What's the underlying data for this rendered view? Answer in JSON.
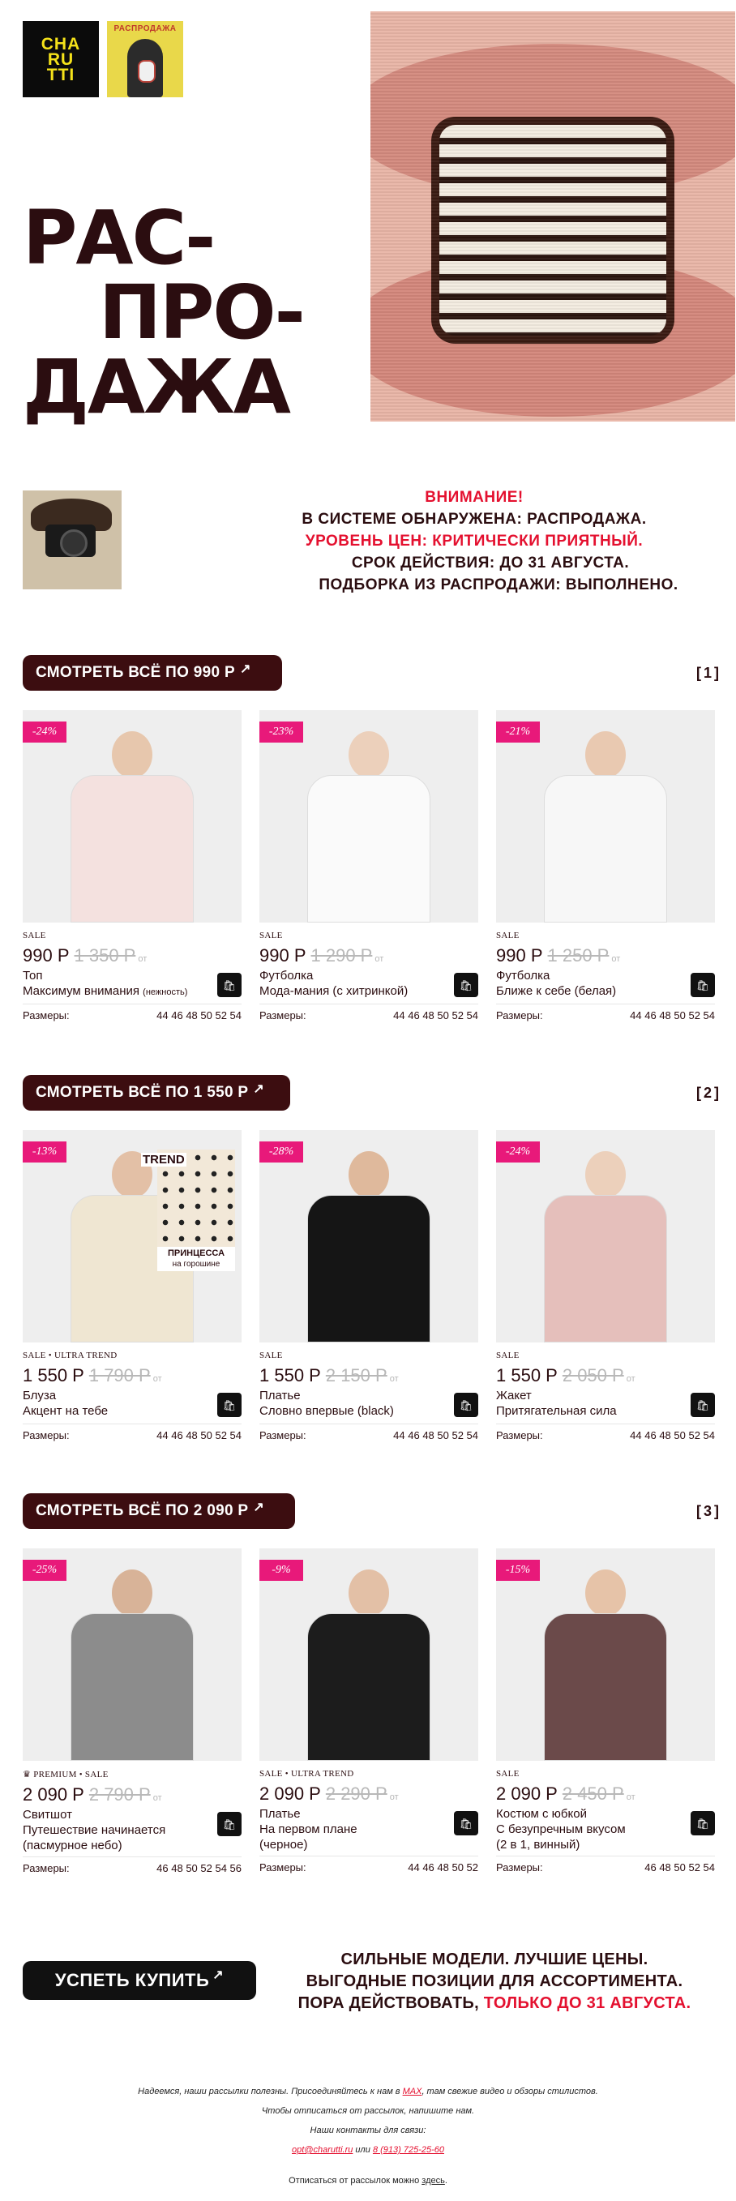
{
  "header": {
    "logo_text": "CHA RU TTI",
    "promo_label": "РАСПРОДАЖА",
    "title_lines": [
      "РАС-",
      "ПРО-",
      "ДАЖА"
    ]
  },
  "notice": {
    "lines": [
      {
        "text": "ВНИМАНИЕ!",
        "red": true
      },
      {
        "text": "В СИСТЕМЕ ОБНАРУЖЕНА: РАСПРОДАЖА.",
        "red": false
      },
      {
        "text": "УРОВЕНЬ ЦЕН: КРИТИЧЕСКИ ПРИЯТНЫЙ.",
        "red": true
      },
      {
        "text": "СРОК ДЕЙСТВИЯ: ДО 31 АВГУСТА.",
        "red": false
      },
      {
        "text": "ПОДБОРКА ИЗ РАСПРОДАЖИ: ВЫПОЛНЕНО.",
        "red": false
      }
    ]
  },
  "sections": [
    {
      "button": "СМОТРЕТЬ ВСЁ ПО 990 Р",
      "number": "[1]",
      "products": [
        {
          "badge": "-24%",
          "tag": "SALE",
          "price": "990 Р",
          "old_price": "1 350 Р",
          "from": "от",
          "line1": "Топ",
          "line2": "Максимум внимания",
          "line2_small": "(нежность)",
          "sizes_label": "Размеры:",
          "sizes": "44 46 48 50 52 54",
          "skin": "#e7c7ad",
          "outfit": "#f4e1df"
        },
        {
          "badge": "-23%",
          "tag": "SALE",
          "price": "990 Р",
          "old_price": "1 290 Р",
          "from": "от",
          "line1": "Футболка",
          "line2": "Мода-мания (с хитринкой)",
          "line2_small": "",
          "sizes_label": "Размеры:",
          "sizes": "44 46 48 50 52 54",
          "skin": "#ecd0bb",
          "outfit": "#fafafa"
        },
        {
          "badge": "-21%",
          "tag": "SALE",
          "price": "990 Р",
          "old_price": "1 250 Р",
          "from": "от",
          "line1": "Футболка",
          "line2": "Ближе к себе (белая)",
          "line2_small": "",
          "sizes_label": "Размеры:",
          "sizes": "44 46 48 50 52 54",
          "skin": "#e9c9b1",
          "outfit": "#f7f7f7"
        }
      ]
    },
    {
      "button": "СМОТРЕТЬ ВСЁ ПО 1 550 Р",
      "number": "[2]",
      "products": [
        {
          "badge": "-13%",
          "tag": "SALE • ULTRA TREND",
          "price": "1 550 Р",
          "old_price": "1 790 Р",
          "from": "от",
          "line1": "Блуза",
          "line2": "Акцент на тебе",
          "line2_small": "",
          "sizes_label": "Размеры:",
          "sizes": "44 46 48 50 52 54",
          "skin": "#e3c0a6",
          "outfit": "#efe6d2",
          "trend": "TREND",
          "trend_caption_1": "ПРИНЦЕССА",
          "trend_caption_2": "на горошине"
        },
        {
          "badge": "-28%",
          "tag": "SALE",
          "price": "1 550 Р",
          "old_price": "2 150 Р",
          "from": "от",
          "line1": "Платье",
          "line2": "Словно впервые (black)",
          "line2_small": "",
          "sizes_label": "Размеры:",
          "sizes": "44 46 48 50 52 54",
          "skin": "#dfb99c",
          "outfit": "#151515"
        },
        {
          "badge": "-24%",
          "tag": "SALE",
          "price": "1 550 Р",
          "old_price": "2 050 Р",
          "from": "от",
          "line1": "Жакет",
          "line2": "Притягательная сила",
          "line2_small": "",
          "sizes_label": "Размеры:",
          "sizes": "44 46 48 50 52 54",
          "skin": "#ecd0bb",
          "outfit": "#e5bfbb"
        }
      ]
    },
    {
      "button": "СМОТРЕТЬ ВСЁ ПО 2 090 Р",
      "number": "[3]",
      "products": [
        {
          "badge": "-25%",
          "tag": "♛ PREMIUM • SALE",
          "price": "2 090 Р",
          "old_price": "2 790 Р",
          "from": "от",
          "line1": "Свитшот",
          "line2": "Путешествие начинается",
          "line3": "(пасмурное небо)",
          "line2_small": "",
          "sizes_label": "Размеры:",
          "sizes": "46 48 50 52 54 56",
          "skin": "#d8b398",
          "outfit": "#8c8c8c"
        },
        {
          "badge": "-9%",
          "tag": "SALE • ULTRA TREND",
          "price": "2 090 Р",
          "old_price": "2 290 Р",
          "from": "от",
          "line1": "Платье",
          "line2": "На первом плане",
          "line3": "(черное)",
          "line2_small": "",
          "sizes_label": "Размеры:",
          "sizes": "44 46 48 50 52",
          "skin": "#e3c0a6",
          "outfit": "#1c1c1c"
        },
        {
          "badge": "-15%",
          "tag": "SALE",
          "price": "2 090 Р",
          "old_price": "2 450 Р",
          "from": "от",
          "line1": "Костюм с юбкой",
          "line2": "С безупречным вкусом",
          "line3": "(2 в 1, винный)",
          "line2_small": "",
          "sizes_label": "Размеры:",
          "sizes": "46 48 50 52 54",
          "skin": "#e6c3a8",
          "outfit": "#6b4a4a"
        }
      ]
    }
  ],
  "cta": {
    "button": "УСПЕТЬ КУПИТЬ",
    "slogan_1": "СИЛЬНЫЕ МОДЕЛИ. ЛУЧШИЕ ЦЕНЫ.",
    "slogan_2": "ВЫГОДНЫЕ ПОЗИЦИИ ДЛЯ АССОРТИМЕНТА.",
    "slogan_3_a": "ПОРА ДЕЙСТВОВАТЬ, ",
    "slogan_3_b": "ТОЛЬКО ДО 31 АВГУСТА."
  },
  "footer": {
    "line1_a": "Надеемся, наши рассылки полезны. Присоединяйтесь к нам в ",
    "line1_link": "MAX",
    "line1_b": ", там свежие видео и обзоры стилистов.",
    "line2": "Чтобы отписаться от рассылок, напишите нам.",
    "line3": "Наши контакты для связи:",
    "email": "opt@charutti.ru",
    "or": " или ",
    "phone": "8 (913) 725-25-60",
    "unsub_a": "Отписаться от рассылок можно ",
    "unsub_link": "здесь",
    "unsub_b": "."
  },
  "colors": {
    "accent": "#e4102f",
    "dark": "#3c0d10",
    "badge": "#e8197a"
  }
}
